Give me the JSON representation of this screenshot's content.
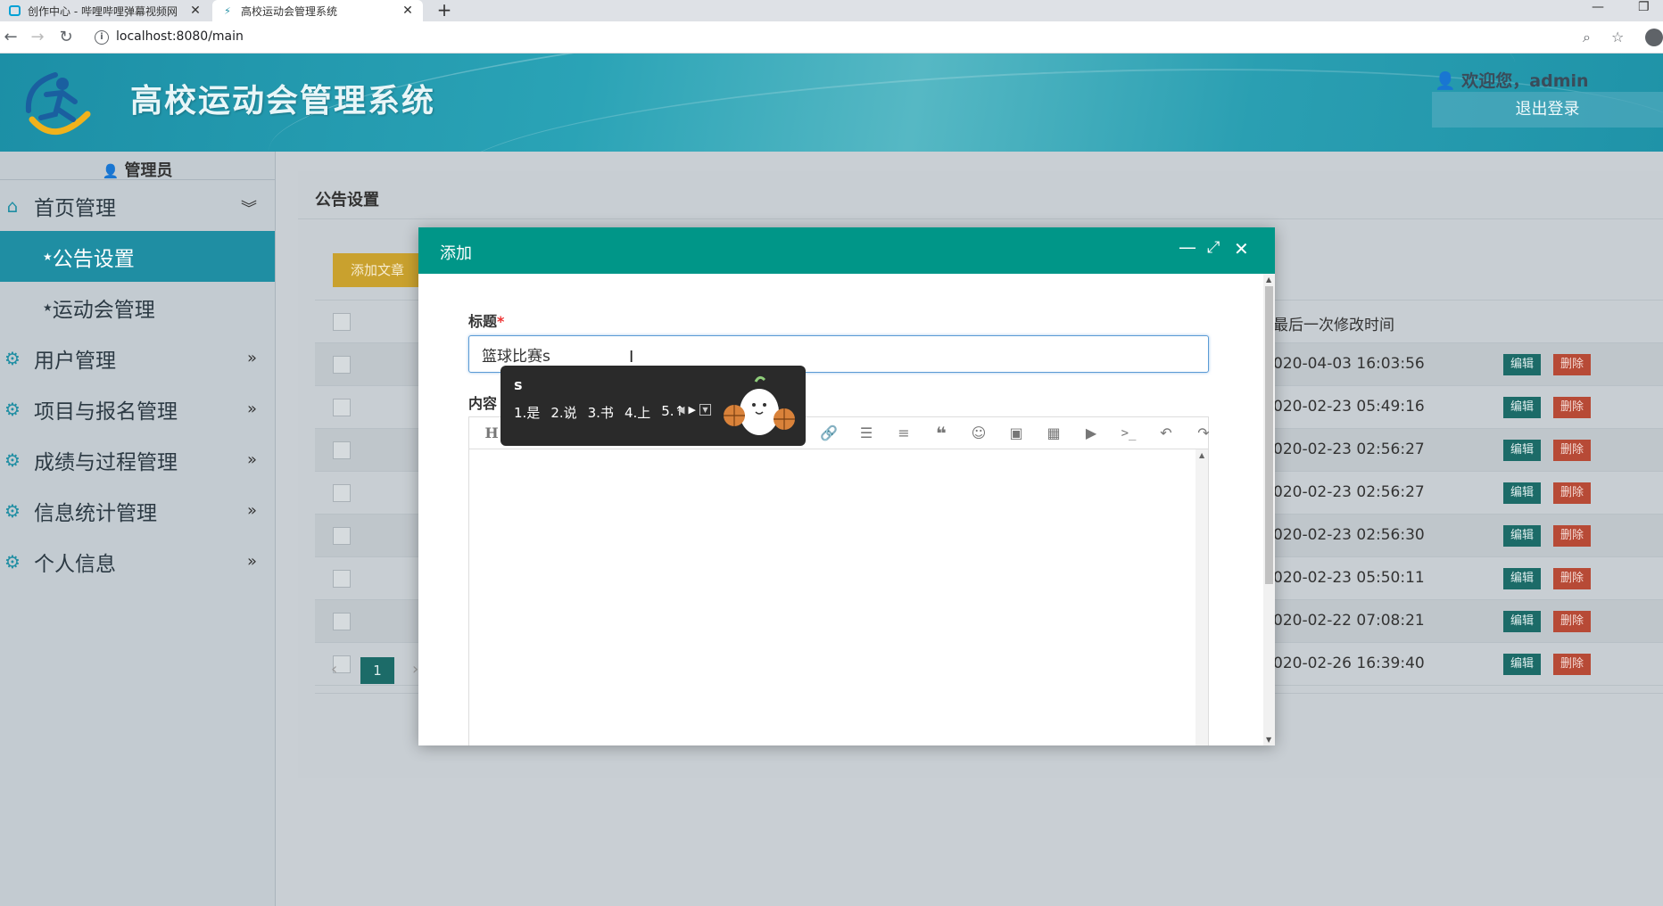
{
  "browser": {
    "tabs": [
      {
        "title": "创作中心 - 哔哩哔哩弹幕视频网"
      },
      {
        "title": "高校运动会管理系统"
      }
    ],
    "new_tab": "+",
    "url": "localhost:8080/main"
  },
  "header": {
    "title": "高校运动会管理系统",
    "welcome": "欢迎您，admin",
    "logout": "退出登录"
  },
  "sidebar": {
    "role": "管理员",
    "menus": [
      {
        "label": "首页管理",
        "icon": "home-icon",
        "expanded": true,
        "children": [
          "公告设置",
          "运动会管理"
        ]
      },
      {
        "label": "用户管理",
        "icon": "gear-icon"
      },
      {
        "label": "项目与报名管理",
        "icon": "gear-icon"
      },
      {
        "label": "成绩与过程管理",
        "icon": "gear-icon"
      },
      {
        "label": "信息统计管理",
        "icon": "gear-icon"
      },
      {
        "label": "个人信息",
        "icon": "gear-icon"
      }
    ]
  },
  "main": {
    "title": "公告设置",
    "add_button": "添加文章",
    "columns": {
      "last_modified": "最后一次修改时间"
    },
    "rows": [
      {
        "time": "020-04-03 16:03:56"
      },
      {
        "time": "020-02-23 05:49:16"
      },
      {
        "time": "020-02-23 02:56:27"
      },
      {
        "time": "020-02-23 02:56:27"
      },
      {
        "time": "020-02-23 02:56:30"
      },
      {
        "time": "020-02-23 05:50:11"
      },
      {
        "time": "020-02-22 07:08:21"
      },
      {
        "time": "020-02-26 16:39:40"
      }
    ],
    "edit_label": "编辑",
    "delete_label": "删除",
    "page": "1"
  },
  "modal": {
    "title": "添加",
    "title_label": "标题",
    "required_mark": "*",
    "title_value": "篮球比赛s",
    "content_label": "内容",
    "heading_tool": "H"
  },
  "ime": {
    "input": "s",
    "candidates": [
      "1.是",
      "2.说",
      "3.书",
      "4.上",
      "5.↑"
    ]
  },
  "colors": {
    "primary": "#009688",
    "sidebar_active": "#1f8ea3",
    "edit": "#1c6b68",
    "delete": "#b74a36",
    "add": "#c9a12e"
  }
}
